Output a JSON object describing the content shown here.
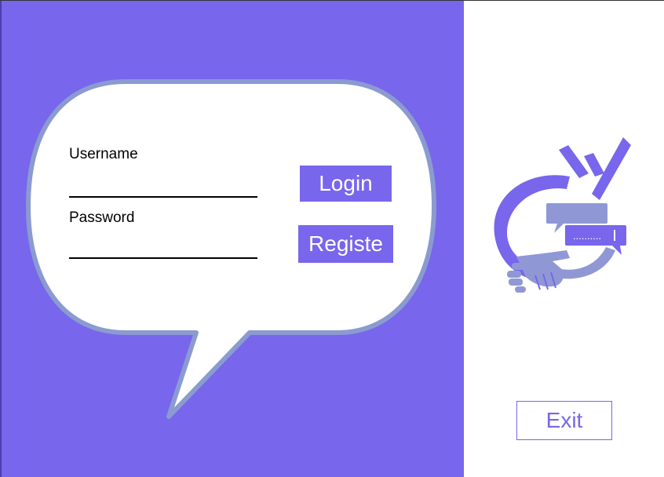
{
  "login_form": {
    "username_label": "Username",
    "username_value": "",
    "password_label": "Password",
    "password_value": "",
    "login_label": "Login",
    "register_label": "Registe"
  },
  "logo": {
    "icon": "chat-handshake-logo-icon",
    "password_dots": ".........."
  },
  "exit_label": "Exit",
  "colors": {
    "accent": "#7866ec",
    "bubble_border": "#8b9bd0",
    "logo_light": "#8f98d4"
  }
}
